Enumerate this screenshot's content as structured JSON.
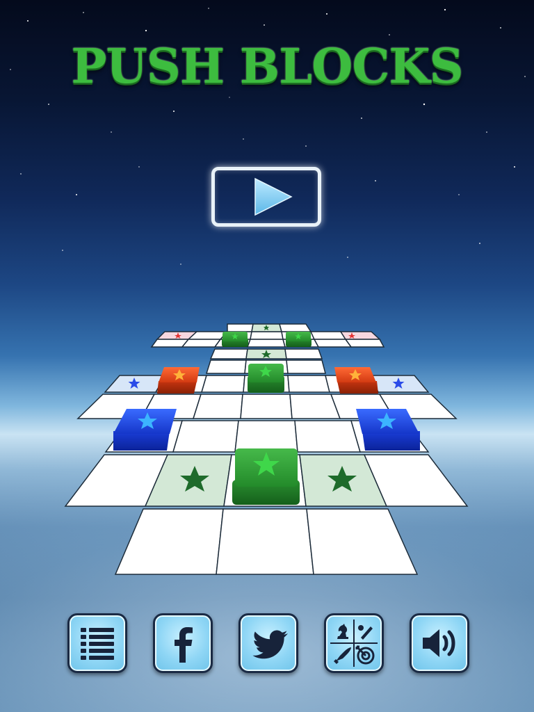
{
  "title": "PUSH BLOCKS",
  "play_button": {
    "icon": "play-icon"
  },
  "board": {
    "tile_color": "#ffffff",
    "target_tile_color": "#d3e8d6",
    "block_colors": {
      "green": "#2f9b35",
      "red": "#e0461c",
      "blue": "#1f4fe0"
    }
  },
  "bottom_bar": [
    {
      "id": "menu",
      "icon": "list-icon"
    },
    {
      "id": "facebook",
      "icon": "facebook-icon"
    },
    {
      "id": "twitter",
      "icon": "twitter-bird-icon"
    },
    {
      "id": "game-center",
      "icon": "game-center-icon"
    },
    {
      "id": "sound",
      "icon": "speaker-icon"
    }
  ],
  "colors": {
    "title_green": "#3dbc3f",
    "button_cyan": "#8fd6f5",
    "button_border": "#1a2a44"
  }
}
